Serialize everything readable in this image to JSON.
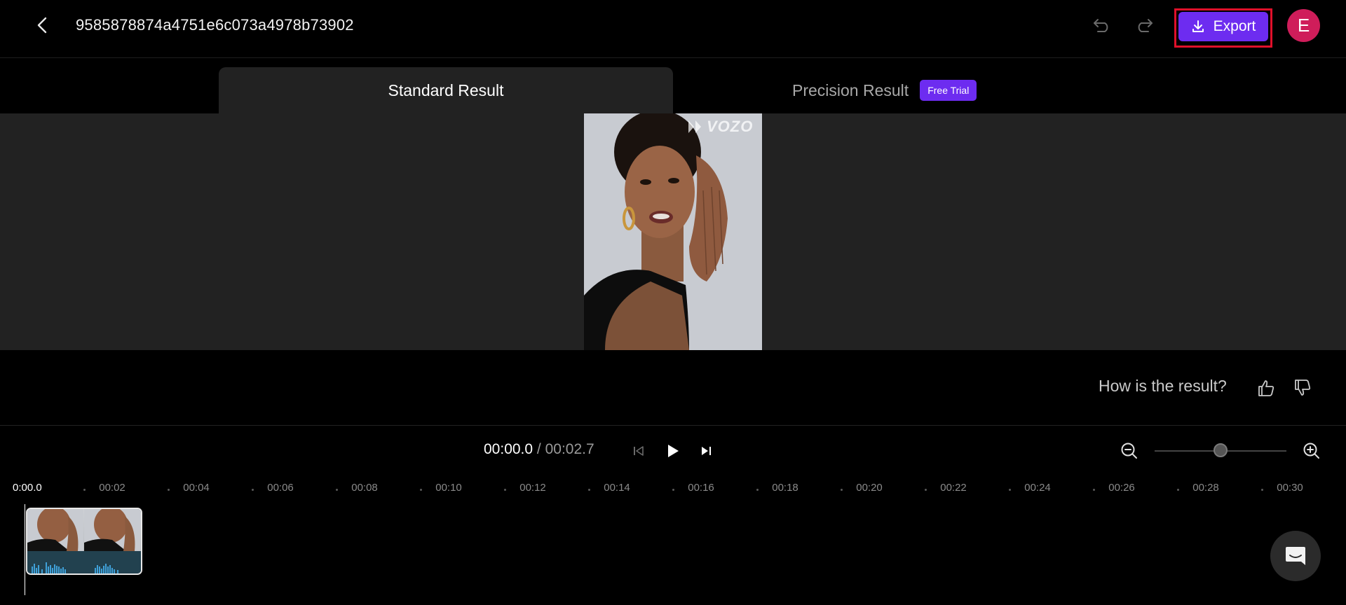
{
  "header": {
    "title": "9585878874a4751e6c073a4978b73902",
    "export_label": "Export",
    "avatar_initial": "E"
  },
  "tabs": {
    "standard": "Standard Result",
    "precision": "Precision Result",
    "precision_badge": "Free Trial"
  },
  "preview": {
    "watermark": "VOZO"
  },
  "feedback": {
    "prompt": "How is the result?"
  },
  "playback": {
    "current_time": "00:00.0",
    "separator": " / ",
    "total_time": "00:02.7"
  },
  "zoom": {
    "level": 0.5
  },
  "timeline": {
    "start_label": "0:00.0",
    "ticks": [
      "00:02",
      "00:04",
      "00:06",
      "00:08",
      "00:10",
      "00:12",
      "00:14",
      "00:16",
      "00:18",
      "00:20",
      "00:22",
      "00:24",
      "00:26",
      "00:28",
      "00:30"
    ]
  },
  "colors": {
    "accent": "#6d2cf0",
    "avatar": "#cf1d5a",
    "highlight_outline": "#e0102a",
    "panel": "#222222"
  },
  "icons": {
    "back": "chevron-left-icon",
    "undo": "undo-icon",
    "redo": "redo-icon",
    "export": "download-icon",
    "like": "thumbs-up-icon",
    "dislike": "thumbs-down-icon",
    "prev": "skip-previous-icon",
    "play": "play-icon",
    "next": "skip-next-icon",
    "zoom_out": "zoom-out-icon",
    "zoom_in": "zoom-in-icon",
    "chat": "chat-icon"
  }
}
